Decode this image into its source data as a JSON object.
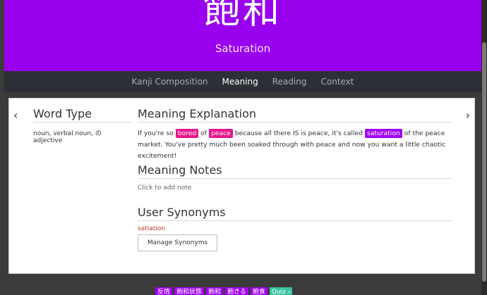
{
  "header": {
    "kanji": "飽和",
    "meaning": "Saturation"
  },
  "tabs": [
    {
      "label": "Kanji Composition"
    },
    {
      "label": "Meaning"
    },
    {
      "label": "Reading"
    },
    {
      "label": "Context"
    }
  ],
  "arrows": {
    "prev": "‹",
    "next": "›"
  },
  "word_type": {
    "heading": "Word Type",
    "text": "noun, verbal noun, の adjective"
  },
  "meaning_explanation": {
    "heading": "Meaning Explanation",
    "part1": "If you're so ",
    "h1": "bored",
    "part2": " of ",
    "h2": "peace",
    "part3": " because all there IS is peace, it's called ",
    "h3": "saturation",
    "part4": " of the peace market. You've pretty much been soaked through with peace and now you want a little chaotic excitement!"
  },
  "meaning_notes": {
    "heading": "Meaning Notes",
    "placeholder": "Click to add note"
  },
  "user_synonyms": {
    "heading": "User Synonyms",
    "synonym": "satiation",
    "button": "Manage Synonyms"
  },
  "footer": {
    "buttons": [
      "反情",
      "飽和状態",
      "飽和",
      "飽きる",
      "飽食",
      "Quiz ›"
    ]
  }
}
